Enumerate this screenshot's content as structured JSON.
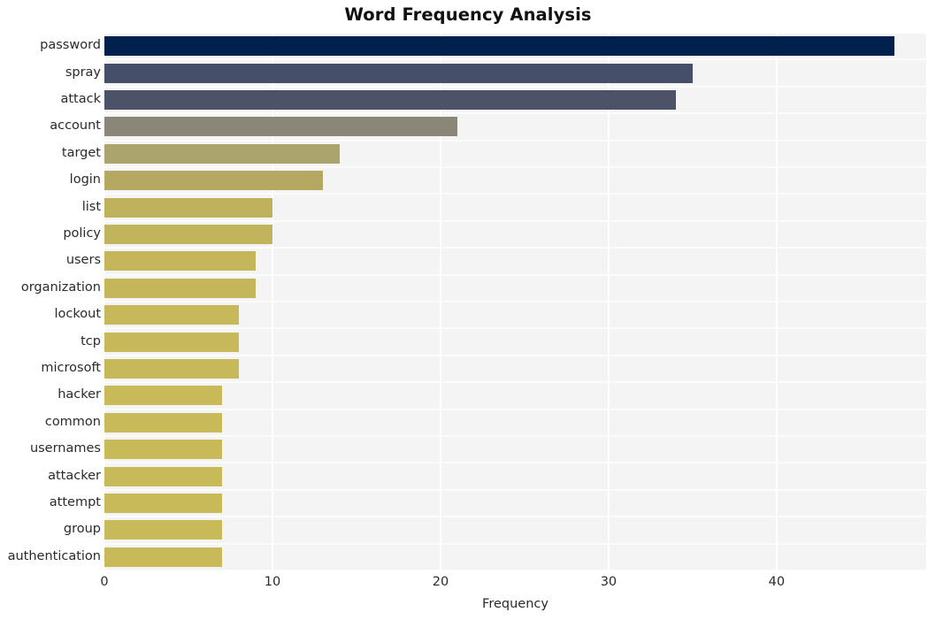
{
  "chart_data": {
    "type": "bar",
    "orientation": "horizontal",
    "title": "Word Frequency Analysis",
    "xlabel": "Frequency",
    "ylabel": "",
    "xlim": [
      0,
      48.9
    ],
    "xticks": [
      0,
      10,
      20,
      30,
      40
    ],
    "xtick_labels": [
      "0",
      "10",
      "20",
      "30",
      "40"
    ],
    "grid": true,
    "legend": "none",
    "categories": [
      "password",
      "spray",
      "attack",
      "account",
      "target",
      "login",
      "list",
      "policy",
      "users",
      "organization",
      "lockout",
      "tcp",
      "microsoft",
      "hacker",
      "common",
      "usernames",
      "attacker",
      "attempt",
      "group",
      "authentication"
    ],
    "values": [
      47,
      35,
      34,
      21,
      14,
      13,
      10,
      10,
      9,
      9,
      8,
      8,
      8,
      7,
      7,
      7,
      7,
      7,
      7,
      7
    ],
    "bar_colors": [
      "#00204e",
      "#454f69",
      "#4c5369",
      "#8a8678",
      "#aba46c",
      "#b5a863",
      "#c0b25d",
      "#c2b45c",
      "#c5b65b",
      "#c5b65b",
      "#c7b85a",
      "#c7b85a",
      "#c7b85a",
      "#c9ba59",
      "#c9ba59",
      "#c9ba59",
      "#c9ba59",
      "#c9ba59",
      "#c9ba59",
      "#c9ba59"
    ]
  },
  "style": {
    "figure_background": "#ffffff",
    "plot_background": "#f4f4f5",
    "grid_color": "#ffffff",
    "title_color": "#111111",
    "tick_color": "#2b2b2b"
  }
}
